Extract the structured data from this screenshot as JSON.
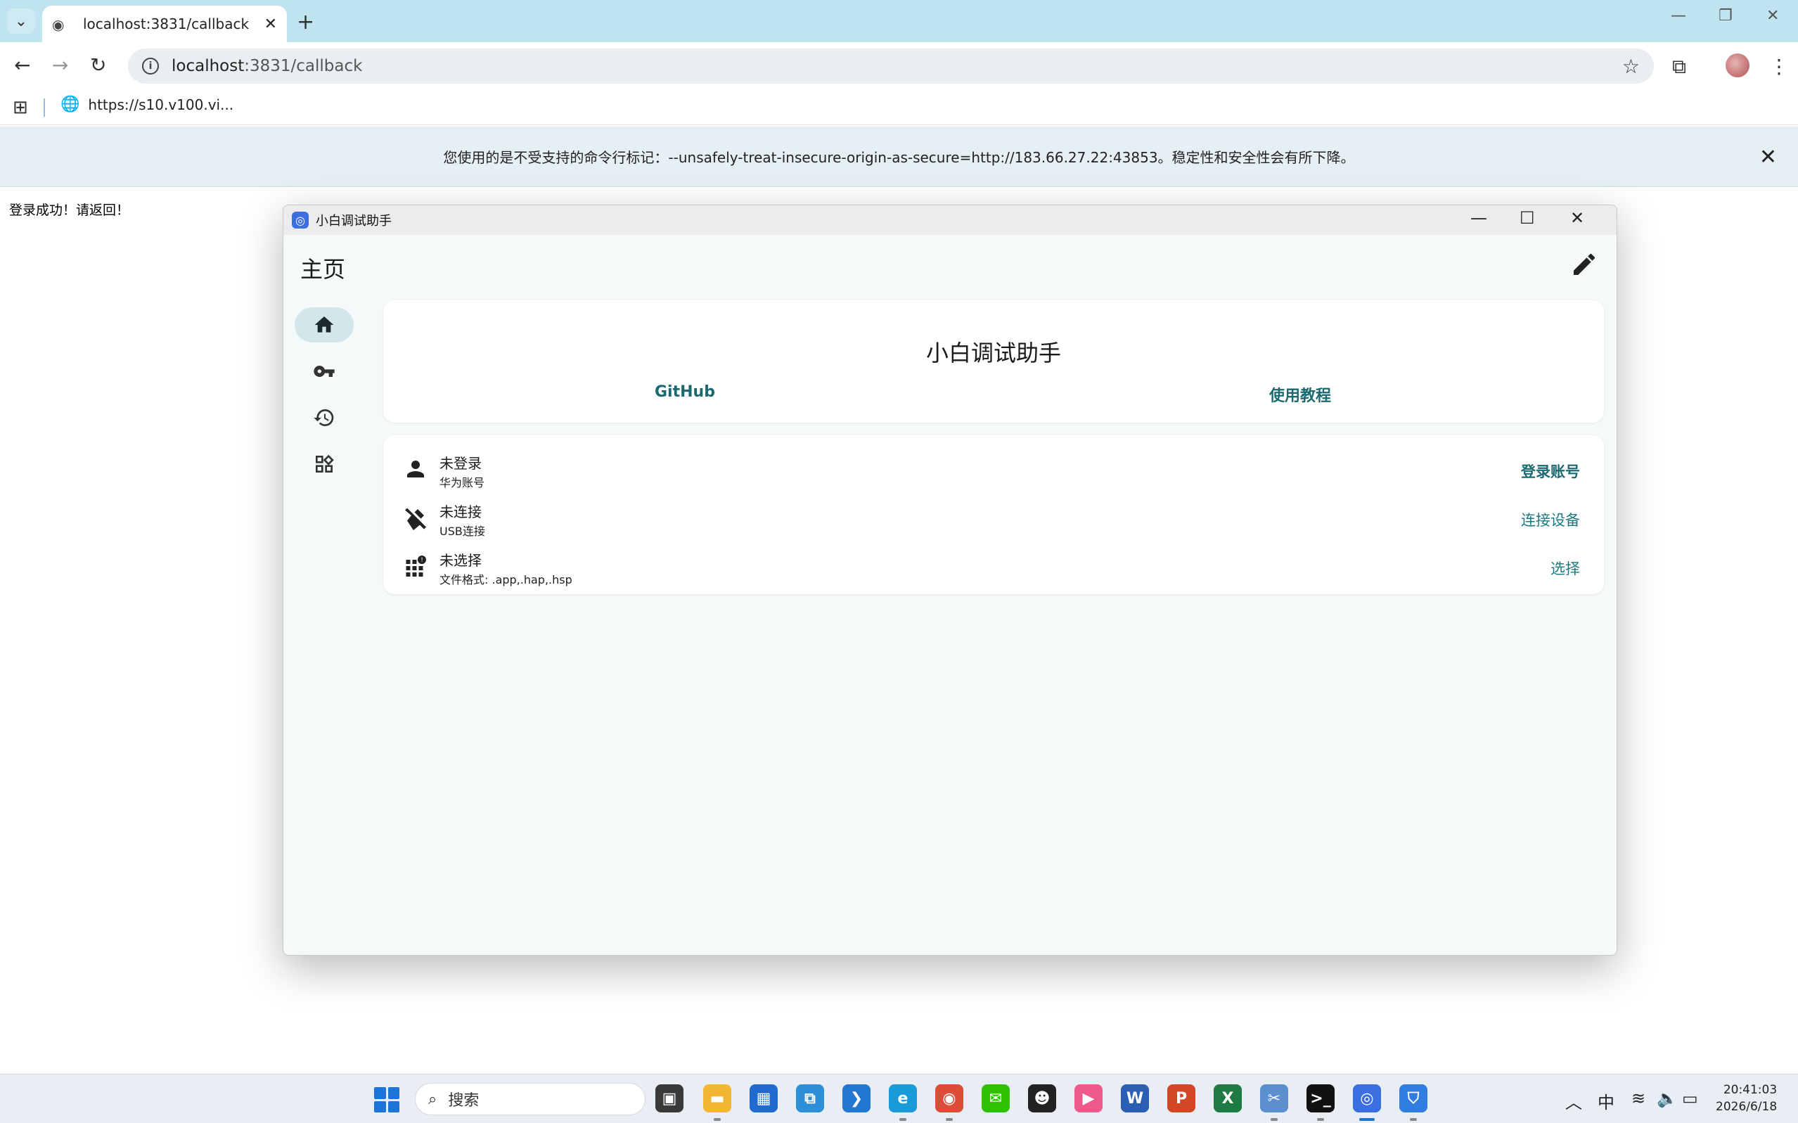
{
  "browser": {
    "tab_title": "localhost:3831/callback",
    "url_host": "localhost",
    "url_rest": ":3831/callback",
    "bookmark_label": "https://s10.v100.vi...",
    "infobar_message": "您使用的是不受支持的命令行标记：--unsafely-treat-insecure-origin-as-secure=http://183.66.27.22:43853。稳定性和安全性会有所下降。"
  },
  "page": {
    "body_text": "登录成功！请返回！"
  },
  "app": {
    "window_title": "小白调试助手",
    "page_title": "主页",
    "hero": {
      "title": "小白调试助手",
      "link_github": "GitHub",
      "link_tutorial": "使用教程"
    },
    "rows": [
      {
        "title": "未登录",
        "subtitle": "华为账号",
        "action": "登录账号",
        "icon": "person-icon"
      },
      {
        "title": "未连接",
        "subtitle": "USB连接",
        "action": "连接设备",
        "icon": "usb-off-icon"
      },
      {
        "title": "未选择",
        "subtitle": "文件格式: .app,.hap,.hsp",
        "action": "选择",
        "icon": "apps-badge-icon"
      }
    ],
    "nav": [
      "home-icon",
      "key-icon",
      "history-icon",
      "widgets-icon"
    ]
  },
  "taskbar": {
    "search_placeholder": "搜索",
    "ime": "中",
    "time": "20:41:03",
    "date": "2026/6/18"
  },
  "colors": {
    "accent": "#1b6a72",
    "rail_active": "#d3e6ec",
    "app_bg": "#f4f9f9",
    "chrome_tabstrip": "#bfe3ef"
  }
}
